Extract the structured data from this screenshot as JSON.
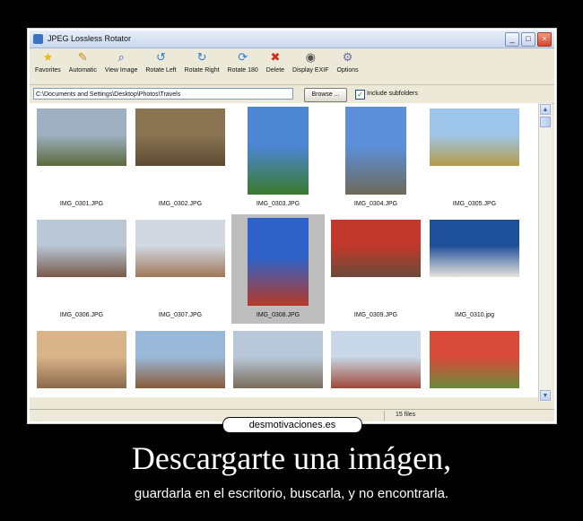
{
  "window": {
    "title": "JPEG Lossless Rotator",
    "min": "_",
    "max": "□",
    "close": "×"
  },
  "toolbar": [
    {
      "label": "Favorites",
      "icon": "star-icon",
      "glyph": "★",
      "color": "#e8b818"
    },
    {
      "label": "Automatic",
      "icon": "magic-wand-icon",
      "glyph": "✎",
      "color": "#c98a1a"
    },
    {
      "label": "View Image",
      "icon": "magnifier-icon",
      "glyph": "⌕",
      "color": "#3a66b5"
    },
    {
      "label": "Rotate Left",
      "icon": "rotate-left-icon",
      "glyph": "↺",
      "color": "#2f7fd6"
    },
    {
      "label": "Rotate Right",
      "icon": "rotate-right-icon",
      "glyph": "↻",
      "color": "#2f7fd6"
    },
    {
      "label": "Rotate 180",
      "icon": "rotate-180-icon",
      "glyph": "⟳",
      "color": "#2f7fd6"
    },
    {
      "label": "Delete",
      "icon": "delete-x-icon",
      "glyph": "✖",
      "color": "#d62b1f"
    },
    {
      "label": "Display EXIF",
      "icon": "camera-icon",
      "glyph": "◉",
      "color": "#555"
    },
    {
      "label": "Options",
      "icon": "options-icon",
      "glyph": "⚙",
      "color": "#6a6aa8"
    }
  ],
  "path": {
    "value": "C:\\Documents and Settings\\Desktop\\Photos\\Travels",
    "browse_label": "Browse ...",
    "include_subfolders": "Include subfolders",
    "checked": true
  },
  "files": [
    {
      "name": "IMG_0301.JPG",
      "c1": "#9fb0c2",
      "c2": "#5a6a3e",
      "orient": "land"
    },
    {
      "name": "IMG_0302.JPG",
      "c1": "#8a7452",
      "c2": "#5b4a32",
      "orient": "land"
    },
    {
      "name": "IMG_0303.JPG",
      "c1": "#4d86d2",
      "c2": "#3a7a2c",
      "orient": "port"
    },
    {
      "name": "IMG_0304.JPG",
      "c1": "#5b8fd8",
      "c2": "#6e6a5a",
      "orient": "port"
    },
    {
      "name": "IMG_0305.JPG",
      "c1": "#9ec6ea",
      "c2": "#b49a48",
      "orient": "land"
    },
    {
      "name": "IMG_0306.JPG",
      "c1": "#b9c7d6",
      "c2": "#7a5a4a",
      "orient": "land"
    },
    {
      "name": "IMG_0307.JPG",
      "c1": "#d2d8e2",
      "c2": "#a07858",
      "orient": "land"
    },
    {
      "name": "IMG_0308.JPG",
      "c1": "#2f62c8",
      "c2": "#b63a28",
      "orient": "port",
      "selected": true
    },
    {
      "name": "IMG_0309.JPG",
      "c1": "#c0392b",
      "c2": "#6b4a3a",
      "orient": "land"
    },
    {
      "name": "IMG_0310.jpg",
      "c1": "#1e4f9a",
      "c2": "#e8e4dc",
      "orient": "land"
    },
    {
      "name": "",
      "c1": "#d9b48a",
      "c2": "#8a6a4a",
      "orient": "land"
    },
    {
      "name": "",
      "c1": "#9ab8d8",
      "c2": "#8a5a3a",
      "orient": "land"
    },
    {
      "name": "",
      "c1": "#b8c8d8",
      "c2": "#7a6a5a",
      "orient": "land"
    },
    {
      "name": "",
      "c1": "#c8d8e8",
      "c2": "#a04838",
      "orient": "land"
    },
    {
      "name": "",
      "c1": "#d84a3a",
      "c2": "#6a8a3a",
      "orient": "land"
    }
  ],
  "status": {
    "count": "15 files"
  },
  "watermark": "desmotivaciones.es",
  "caption": {
    "headline": "Descargarte una imágen,",
    "subline": "guardarla en el escritorio, buscarla, y no encontrarla."
  }
}
